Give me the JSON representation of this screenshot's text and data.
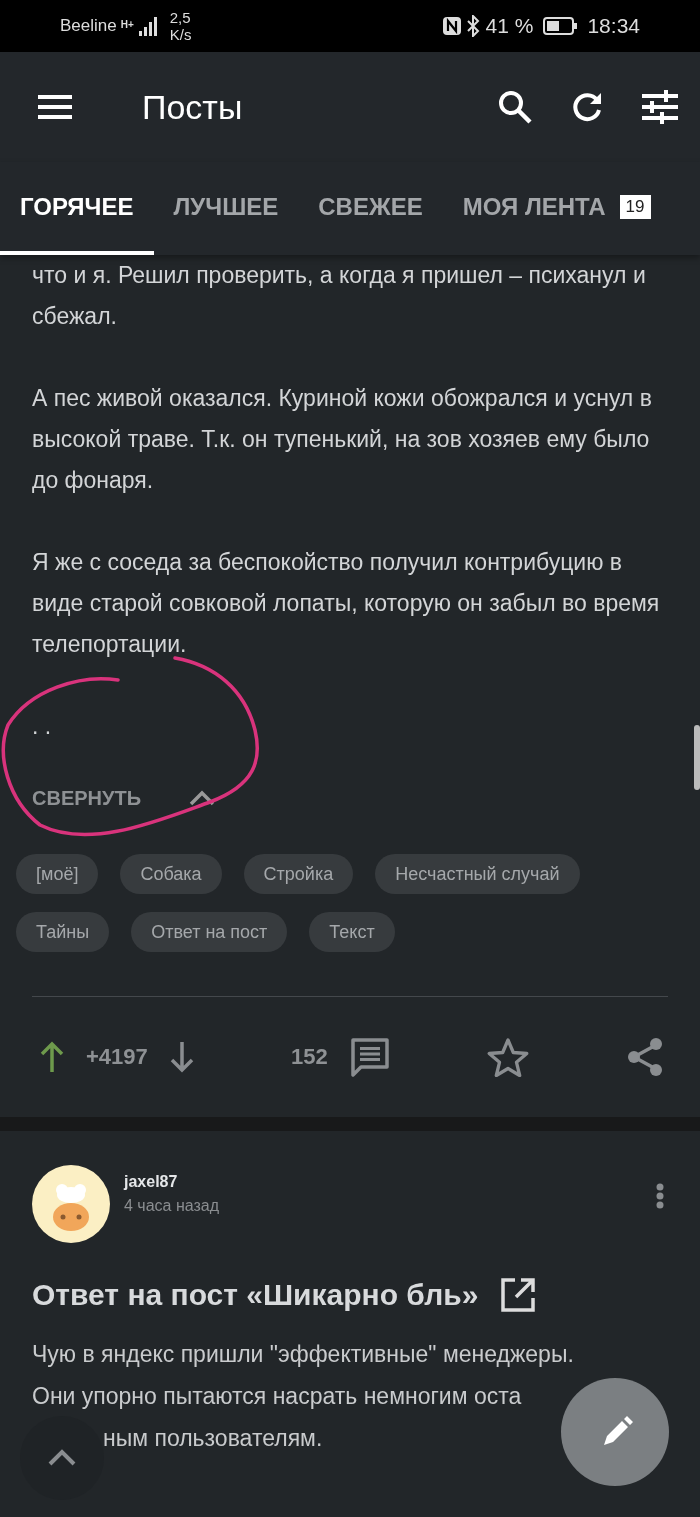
{
  "status_bar": {
    "carrier": "Beeline",
    "network_type": "H+",
    "speed_value": "2,5",
    "speed_unit": "K/s",
    "battery_percent": "41 %",
    "time": "18:34"
  },
  "toolbar": {
    "title": "Посты"
  },
  "tabs": [
    {
      "label": "ГОРЯЧЕЕ",
      "selected": true
    },
    {
      "label": "ЛУЧШЕЕ",
      "selected": false
    },
    {
      "label": "СВЕЖЕЕ",
      "selected": false
    },
    {
      "label": "МОЯ ЛЕНТА",
      "selected": false,
      "badge": "19"
    }
  ],
  "post": {
    "paragraphs": [
      "что и я. Решил проверить, а когда я пришел – психанул и сбежал.",
      "А пес живой оказался. Куриной кожи обожрался и уснул в высокой траве. Т.к. он тупенький, на зов хозяев ему было до фонаря.",
      "Я же с соседа за беспокойство получил контрибуцию в виде старой совковой лопаты, которую он забыл во время телепортации.",
      ". ."
    ],
    "collapse_label": "СВЕРНУТЬ",
    "tags": [
      "[моё]",
      "Собака",
      "Стройка",
      "Несчастный случай",
      "Тайны",
      "Ответ на пост",
      "Текст"
    ],
    "rating": "+4197",
    "comments": "152"
  },
  "next_post": {
    "author": "jaxel87",
    "time": "4 часа назад",
    "title": "Ответ на пост «Шикарно бль»",
    "body_lines": [
      "Чую в яндекс пришли \"эффективные\" менеджеры.",
      "Они упорно пытаются насрать немногим оста",
      "ным пользователям."
    ]
  }
}
